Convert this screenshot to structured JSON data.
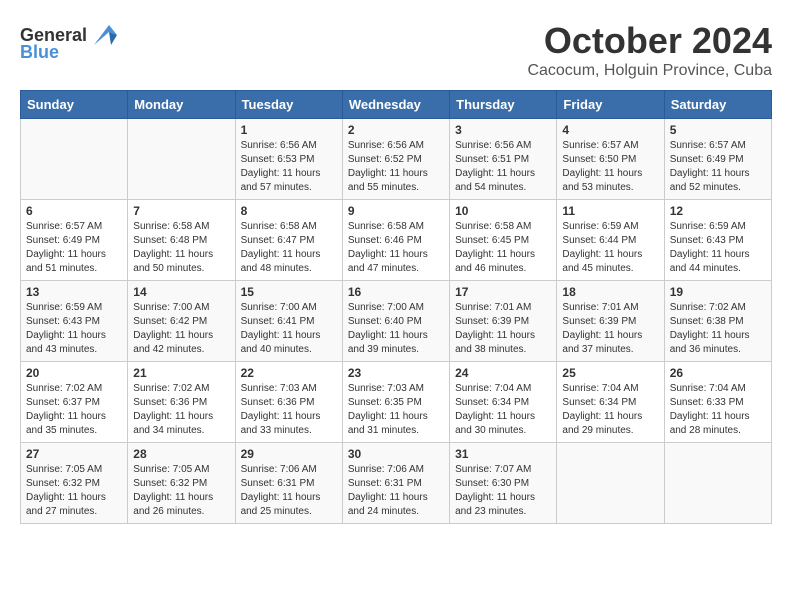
{
  "header": {
    "logo_general": "General",
    "logo_blue": "Blue",
    "month": "October 2024",
    "location": "Cacocum, Holguin Province, Cuba"
  },
  "days_of_week": [
    "Sunday",
    "Monday",
    "Tuesday",
    "Wednesday",
    "Thursday",
    "Friday",
    "Saturday"
  ],
  "weeks": [
    [
      {
        "day": "",
        "info": ""
      },
      {
        "day": "",
        "info": ""
      },
      {
        "day": "1",
        "info": "Sunrise: 6:56 AM\nSunset: 6:53 PM\nDaylight: 11 hours\nand 57 minutes."
      },
      {
        "day": "2",
        "info": "Sunrise: 6:56 AM\nSunset: 6:52 PM\nDaylight: 11 hours\nand 55 minutes."
      },
      {
        "day": "3",
        "info": "Sunrise: 6:56 AM\nSunset: 6:51 PM\nDaylight: 11 hours\nand 54 minutes."
      },
      {
        "day": "4",
        "info": "Sunrise: 6:57 AM\nSunset: 6:50 PM\nDaylight: 11 hours\nand 53 minutes."
      },
      {
        "day": "5",
        "info": "Sunrise: 6:57 AM\nSunset: 6:49 PM\nDaylight: 11 hours\nand 52 minutes."
      }
    ],
    [
      {
        "day": "6",
        "info": "Sunrise: 6:57 AM\nSunset: 6:49 PM\nDaylight: 11 hours\nand 51 minutes."
      },
      {
        "day": "7",
        "info": "Sunrise: 6:58 AM\nSunset: 6:48 PM\nDaylight: 11 hours\nand 50 minutes."
      },
      {
        "day": "8",
        "info": "Sunrise: 6:58 AM\nSunset: 6:47 PM\nDaylight: 11 hours\nand 48 minutes."
      },
      {
        "day": "9",
        "info": "Sunrise: 6:58 AM\nSunset: 6:46 PM\nDaylight: 11 hours\nand 47 minutes."
      },
      {
        "day": "10",
        "info": "Sunrise: 6:58 AM\nSunset: 6:45 PM\nDaylight: 11 hours\nand 46 minutes."
      },
      {
        "day": "11",
        "info": "Sunrise: 6:59 AM\nSunset: 6:44 PM\nDaylight: 11 hours\nand 45 minutes."
      },
      {
        "day": "12",
        "info": "Sunrise: 6:59 AM\nSunset: 6:43 PM\nDaylight: 11 hours\nand 44 minutes."
      }
    ],
    [
      {
        "day": "13",
        "info": "Sunrise: 6:59 AM\nSunset: 6:43 PM\nDaylight: 11 hours\nand 43 minutes."
      },
      {
        "day": "14",
        "info": "Sunrise: 7:00 AM\nSunset: 6:42 PM\nDaylight: 11 hours\nand 42 minutes."
      },
      {
        "day": "15",
        "info": "Sunrise: 7:00 AM\nSunset: 6:41 PM\nDaylight: 11 hours\nand 40 minutes."
      },
      {
        "day": "16",
        "info": "Sunrise: 7:00 AM\nSunset: 6:40 PM\nDaylight: 11 hours\nand 39 minutes."
      },
      {
        "day": "17",
        "info": "Sunrise: 7:01 AM\nSunset: 6:39 PM\nDaylight: 11 hours\nand 38 minutes."
      },
      {
        "day": "18",
        "info": "Sunrise: 7:01 AM\nSunset: 6:39 PM\nDaylight: 11 hours\nand 37 minutes."
      },
      {
        "day": "19",
        "info": "Sunrise: 7:02 AM\nSunset: 6:38 PM\nDaylight: 11 hours\nand 36 minutes."
      }
    ],
    [
      {
        "day": "20",
        "info": "Sunrise: 7:02 AM\nSunset: 6:37 PM\nDaylight: 11 hours\nand 35 minutes."
      },
      {
        "day": "21",
        "info": "Sunrise: 7:02 AM\nSunset: 6:36 PM\nDaylight: 11 hours\nand 34 minutes."
      },
      {
        "day": "22",
        "info": "Sunrise: 7:03 AM\nSunset: 6:36 PM\nDaylight: 11 hours\nand 33 minutes."
      },
      {
        "day": "23",
        "info": "Sunrise: 7:03 AM\nSunset: 6:35 PM\nDaylight: 11 hours\nand 31 minutes."
      },
      {
        "day": "24",
        "info": "Sunrise: 7:04 AM\nSunset: 6:34 PM\nDaylight: 11 hours\nand 30 minutes."
      },
      {
        "day": "25",
        "info": "Sunrise: 7:04 AM\nSunset: 6:34 PM\nDaylight: 11 hours\nand 29 minutes."
      },
      {
        "day": "26",
        "info": "Sunrise: 7:04 AM\nSunset: 6:33 PM\nDaylight: 11 hours\nand 28 minutes."
      }
    ],
    [
      {
        "day": "27",
        "info": "Sunrise: 7:05 AM\nSunset: 6:32 PM\nDaylight: 11 hours\nand 27 minutes."
      },
      {
        "day": "28",
        "info": "Sunrise: 7:05 AM\nSunset: 6:32 PM\nDaylight: 11 hours\nand 26 minutes."
      },
      {
        "day": "29",
        "info": "Sunrise: 7:06 AM\nSunset: 6:31 PM\nDaylight: 11 hours\nand 25 minutes."
      },
      {
        "day": "30",
        "info": "Sunrise: 7:06 AM\nSunset: 6:31 PM\nDaylight: 11 hours\nand 24 minutes."
      },
      {
        "day": "31",
        "info": "Sunrise: 7:07 AM\nSunset: 6:30 PM\nDaylight: 11 hours\nand 23 minutes."
      },
      {
        "day": "",
        "info": ""
      },
      {
        "day": "",
        "info": ""
      }
    ]
  ]
}
